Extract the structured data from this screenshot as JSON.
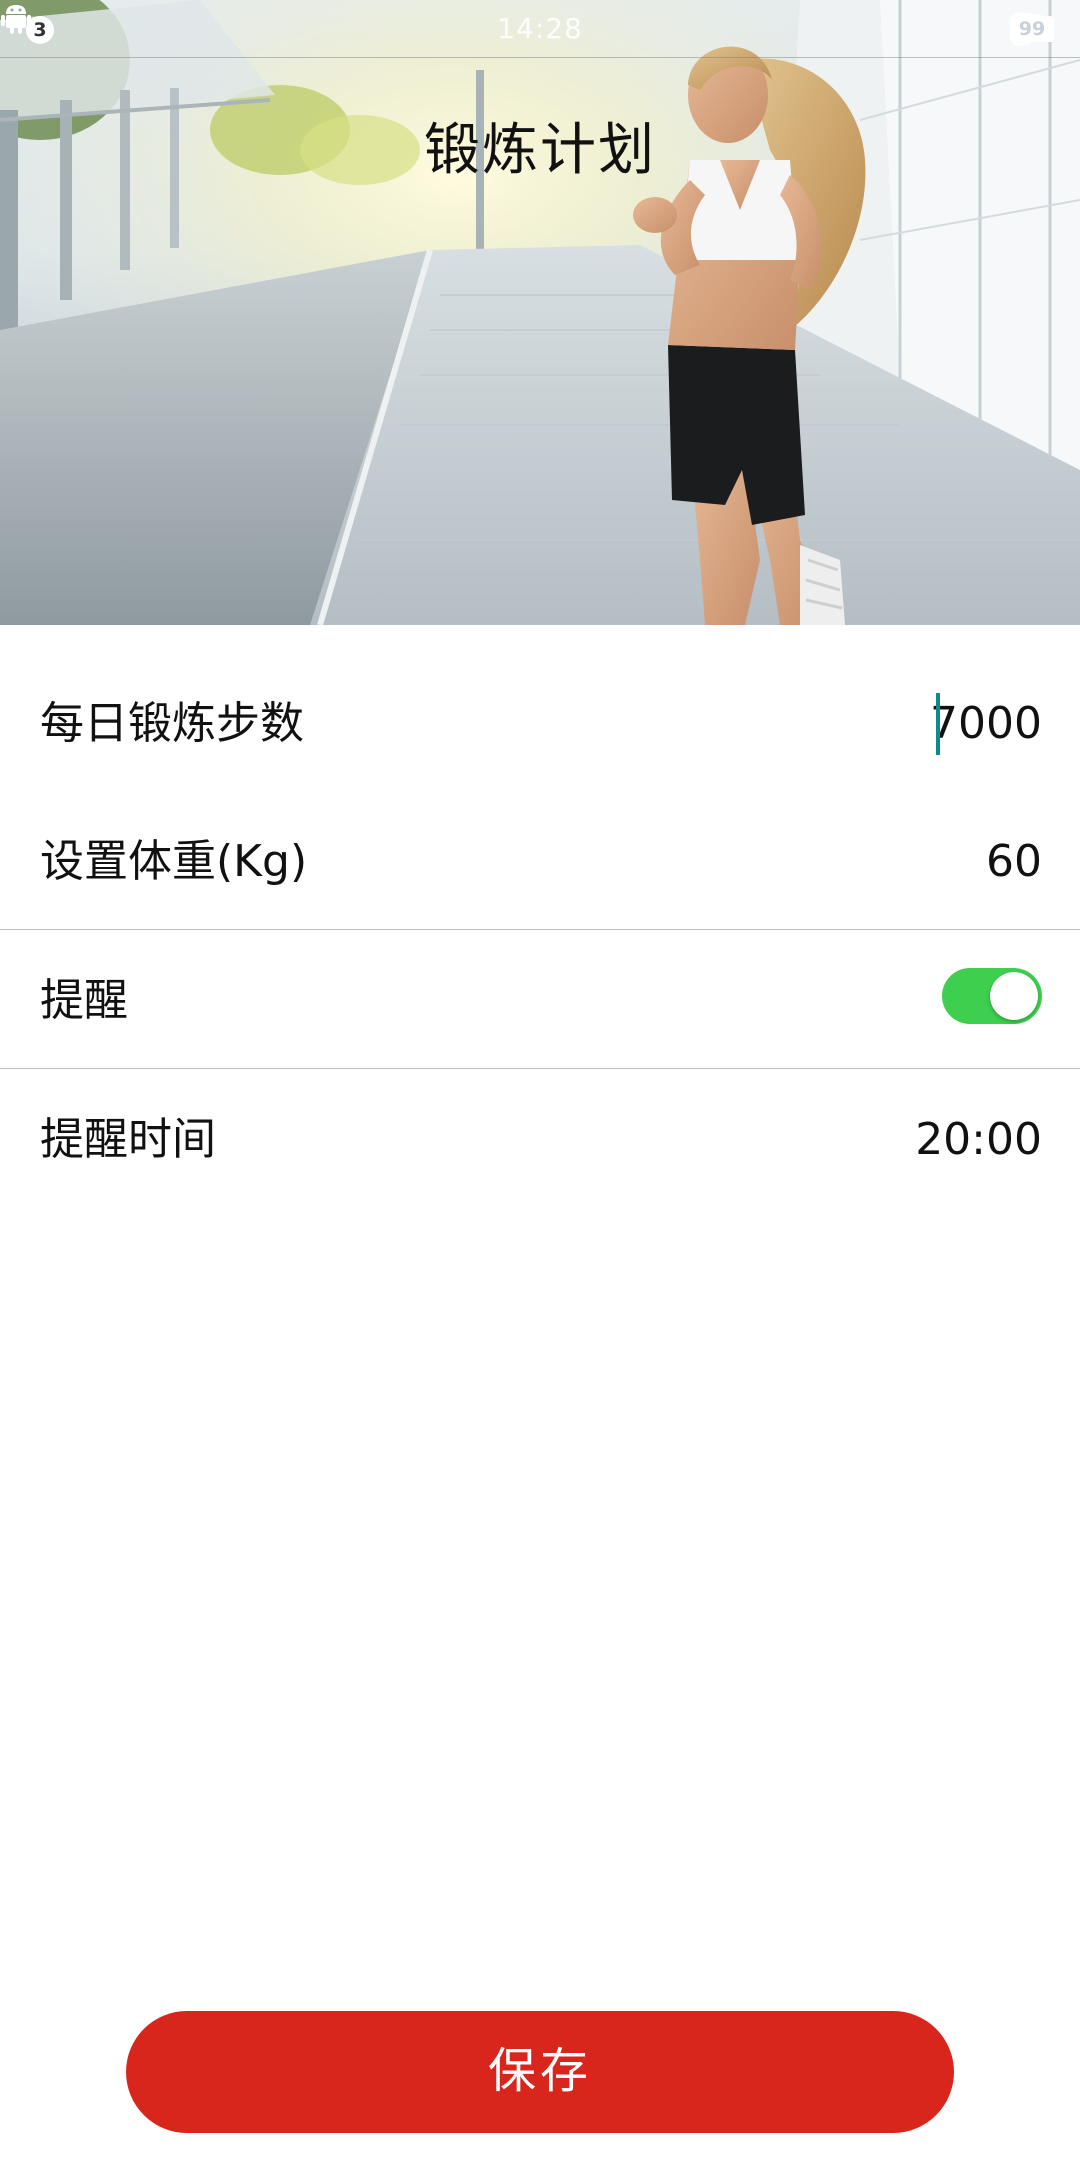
{
  "status_bar": {
    "notification_count": "3",
    "time": "14:28",
    "battery": "99"
  },
  "header": {
    "title": "锻炼计划"
  },
  "settings": {
    "daily_steps": {
      "label": "每日锻炼步数",
      "value": "7000"
    },
    "weight": {
      "label": "设置体重(Kg)",
      "value": "60"
    },
    "reminder": {
      "label": "提醒",
      "enabled": true
    },
    "reminder_time": {
      "label": "提醒时间",
      "value": "20:00"
    }
  },
  "actions": {
    "save_label": "保存"
  },
  "colors": {
    "accent_red": "#d9261c",
    "toggle_on": "#3ecf4f",
    "cursor": "#0d8a8a"
  },
  "icons": [
    "android-icon",
    "alarm-icon",
    "vibrate-icon",
    "wifi-icon",
    "signal-icon",
    "battery-icon"
  ]
}
